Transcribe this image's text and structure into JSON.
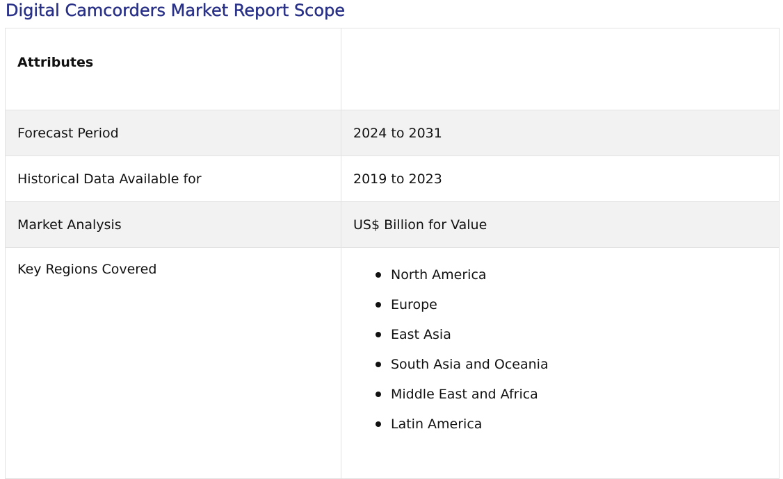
{
  "title": "Digital Camcorders Market Report Scope",
  "table": {
    "header": {
      "col1": "Attributes",
      "col2": ""
    },
    "rows": [
      {
        "attribute": "Forecast Period",
        "value": "2024 to 2031"
      },
      {
        "attribute": "Historical Data Available for",
        "value": "2019 to 2023"
      },
      {
        "attribute": "Market Analysis",
        "value": "US$ Billion for Value"
      }
    ],
    "regions_row": {
      "attribute": "Key Regions Covered",
      "items": [
        "North America",
        "Europe",
        "East Asia",
        "South Asia and Oceania",
        "Middle East and Africa",
        "Latin America"
      ]
    }
  },
  "colors": {
    "title": "#283087",
    "shade_row": "#f2f2f2",
    "border": "#e2e2e2"
  }
}
